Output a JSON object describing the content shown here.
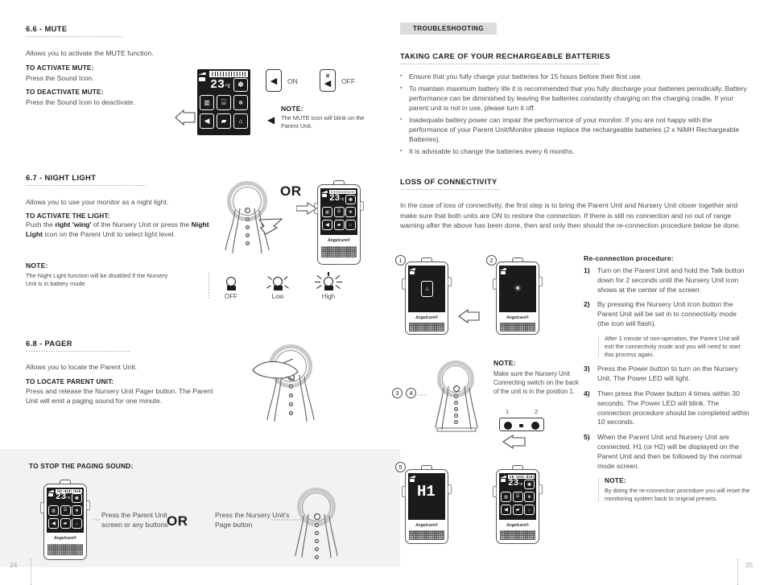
{
  "left_page": {
    "page_number": "24",
    "section_66": {
      "title": "6.6 - MUTE",
      "intro": "Allows you to activate the MUTE function.",
      "activate_label": "TO ACTIVATE MUTE:",
      "activate_text": "Press the Sound Icon.",
      "deactivate_label": "TO DEACTIVATE MUTE:",
      "deactivate_text": "Press the Sound Icon to deactivate.",
      "on_label": "ON",
      "off_label": "OFF",
      "note_label": "NOTE:",
      "note_text": "The MUTE icon will blink on the Parent Unit.",
      "device_temp": "23",
      "device_temp_unit": "°C",
      "device_brand": "Angelcare®"
    },
    "section_67": {
      "title": "6.7 - NIGHT LIGHT",
      "intro": "Allows you to use your monitor as a night light.",
      "activate_label": "TO ACTIVATE THE LIGHT:",
      "activate_text_1": "Push the ",
      "activate_bold_1": "right 'wing'",
      "activate_text_2": " of the Nursery Unit or press the ",
      "activate_bold_2": "Night Light",
      "activate_text_3": " icon on the Parent Unit to select light level.",
      "note_label": "NOTE:",
      "note_text": "The Night Light function will be disabled if the Nursery Unit is in battery mode.",
      "or_label": "OR",
      "levels": [
        "OFF",
        "Low",
        "High"
      ],
      "device_temp": "23",
      "device_temp_unit": "°C",
      "device_brand": "Angelcare®"
    },
    "section_68": {
      "title": "6.8 - PAGER",
      "intro": "Allows you to locate the Parent Unit.",
      "locate_label": "TO LOCATE PARENT UNIT:",
      "locate_text": "Press and release the Nursery Unit Pager button. The Parent Unit will emit a paging sound for one minute."
    },
    "stop_paging": {
      "title": "TO STOP THE PAGING SOUND:",
      "caption_left": "Press the Parent Unit screen or any buttons",
      "or_label": "OR",
      "caption_right": "Press the Nursery Unit's Page button",
      "device_temp": "23",
      "device_temp_unit": "°C",
      "device_brand": "Angelcare®"
    }
  },
  "right_page": {
    "page_number": "25",
    "tab_label": "TROUBLESHOOTING",
    "batteries": {
      "title": "TAKING CARE OF YOUR RECHARGEABLE BATTERIES",
      "bullets": [
        "Ensure that you fully charge your batteries for 15 hours before their first use.",
        "To maintain maximum battery life it is recommended that you fully discharge your batteries periodically. Battery performance can be diminished by leaving the batteries constantly charging on the charging cradle. If your parent unit is not in use, please turn it off.",
        "Inadequate battery power can impair the performance of your monitor. If you are not happy with the performance of your Parent Unit/Monitor please replace the rechargeable batteries (2 x NiMH Rechargeable Batteries).",
        "It is advisable to change the batteries every 6 months."
      ]
    },
    "connectivity": {
      "title": "LOSS OF CONNECTIVITY",
      "intro": "In the case of loss of connectivity, the first step is to bring the Parent Unit and Nursery Unit closer together and make sure that both units are ON to restore the connection. If there is still no connection and no out of range warning after the above has been done, then and only then should the re-connection procedure below be done.",
      "procedure_label": "Re-connection procedure:",
      "steps": [
        {
          "num": "1)",
          "text": "Turn on the Parent Unit and hold the Talk button down for 2 seconds until the Nursery Unit icon shows at the center of the screen."
        },
        {
          "num": "2)",
          "text": "By pressing the Nursery Unit Icon button the Parent Unit will be set in to connectivity mode (the icon will flash)."
        },
        {
          "num": "3)",
          "text": "Press the Power button to turn on the Nursery Unit. The Power LED will light."
        },
        {
          "num": "4)",
          "text": "Then press the Power button 4 times within 30 seconds. The Power LED will blink. The connection procedure should be completed within 10 seconds."
        },
        {
          "num": "5)",
          "text": "When the Parent Unit and Nursery Unit are connected, H1 (or H2) will be displayed on the Parent Unit and then be followed by the normal mode screen."
        }
      ],
      "step2_note": "After 1 minute of non-operation, the Parent Unit will exit the connectivity mode and you will need to start this process again.",
      "step5_note_label": "NOTE:",
      "step5_note": "By doing the re-connection procedure you will reset the monitoring system back to original presets.",
      "callout_1": "1",
      "callout_2": "2",
      "callout_3": "3",
      "callout_4": "4",
      "callout_5": "5",
      "switch_note_label": "NOTE:",
      "switch_note": "Make sure the Nursery Unit Connecting switch on the back of the unit is in the position 1.",
      "switch_pos_1": "1",
      "switch_pos_2": "2",
      "screen_h1": "H1",
      "device_temp": "23",
      "device_temp_unit": "°C",
      "device_brand": "Angelcare®"
    }
  },
  "colors": {
    "tab_bg": "#dcdcdc",
    "panel_bg": "#f2f2f2",
    "ink": "#1c1c1c",
    "body": "#4a4a4a",
    "screen": "#1b1b1b"
  }
}
